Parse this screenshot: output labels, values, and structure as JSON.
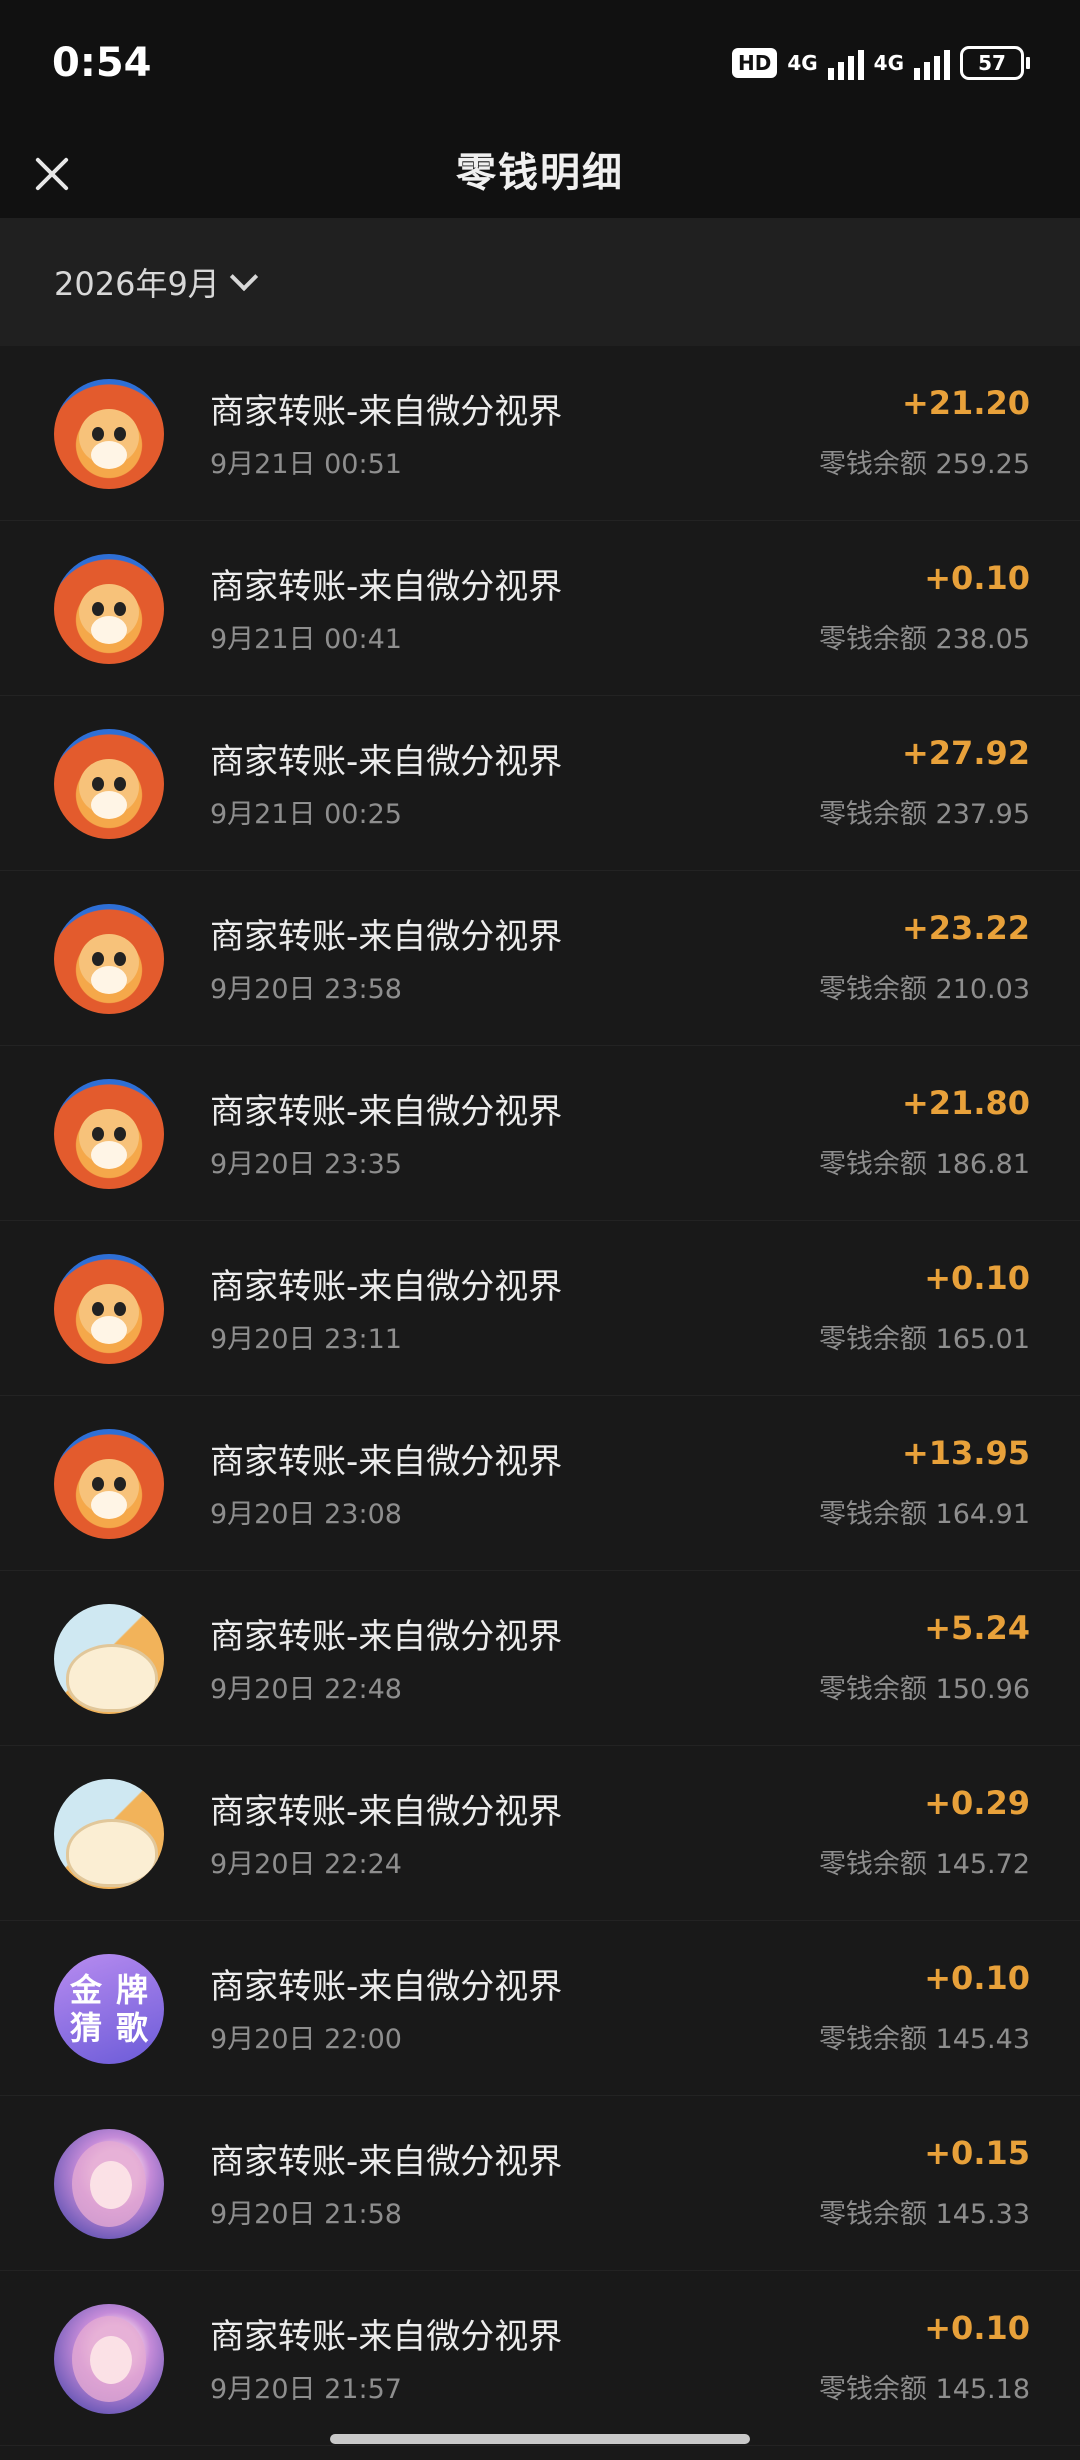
{
  "status": {
    "time": "0:54",
    "hd": "HD",
    "net1": "4G",
    "net2": "4G",
    "battery": "57"
  },
  "header": {
    "title": "零钱明细"
  },
  "filter": {
    "month": "2026年9月"
  },
  "transactions": [
    {
      "title": "商家转账-来自微分视界",
      "time": "9月21日 00:51",
      "amount": "+21.20",
      "balance": "零钱余额 259.25",
      "avatar": "dog"
    },
    {
      "title": "商家转账-来自微分视界",
      "time": "9月21日 00:41",
      "amount": "+0.10",
      "balance": "零钱余额 238.05",
      "avatar": "dog"
    },
    {
      "title": "商家转账-来自微分视界",
      "time": "9月21日 00:25",
      "amount": "+27.92",
      "balance": "零钱余额 237.95",
      "avatar": "dog"
    },
    {
      "title": "商家转账-来自微分视界",
      "time": "9月20日 23:58",
      "amount": "+23.22",
      "balance": "零钱余额 210.03",
      "avatar": "dog"
    },
    {
      "title": "商家转账-来自微分视界",
      "time": "9月20日 23:35",
      "amount": "+21.80",
      "balance": "零钱余额 186.81",
      "avatar": "dog"
    },
    {
      "title": "商家转账-来自微分视界",
      "time": "9月20日 23:11",
      "amount": "+0.10",
      "balance": "零钱余额 165.01",
      "avatar": "dog"
    },
    {
      "title": "商家转账-来自微分视界",
      "time": "9月20日 23:08",
      "amount": "+13.95",
      "balance": "零钱余额 164.91",
      "avatar": "dog"
    },
    {
      "title": "商家转账-来自微分视界",
      "time": "9月20日 22:48",
      "amount": "+5.24",
      "balance": "零钱余额 150.96",
      "avatar": "bun"
    },
    {
      "title": "商家转账-来自微分视界",
      "time": "9月20日 22:24",
      "amount": "+0.29",
      "balance": "零钱余额 145.72",
      "avatar": "bun"
    },
    {
      "title": "商家转账-来自微分视界",
      "time": "9月20日 22:00",
      "amount": "+0.10",
      "balance": "零钱余额 145.43",
      "avatar": "gold",
      "avatar_text": [
        "金",
        "牌",
        "猜",
        "歌"
      ]
    },
    {
      "title": "商家转账-来自微分视界",
      "time": "9月20日 21:58",
      "amount": "+0.15",
      "balance": "零钱余额 145.33",
      "avatar": "girl"
    },
    {
      "title": "商家转账-来自微分视界",
      "time": "9月20日 21:57",
      "amount": "+0.10",
      "balance": "零钱余额 145.18",
      "avatar": "girl"
    }
  ],
  "colors": {
    "amount": "#e8a13a",
    "background": "#191919",
    "header": "#111111"
  }
}
